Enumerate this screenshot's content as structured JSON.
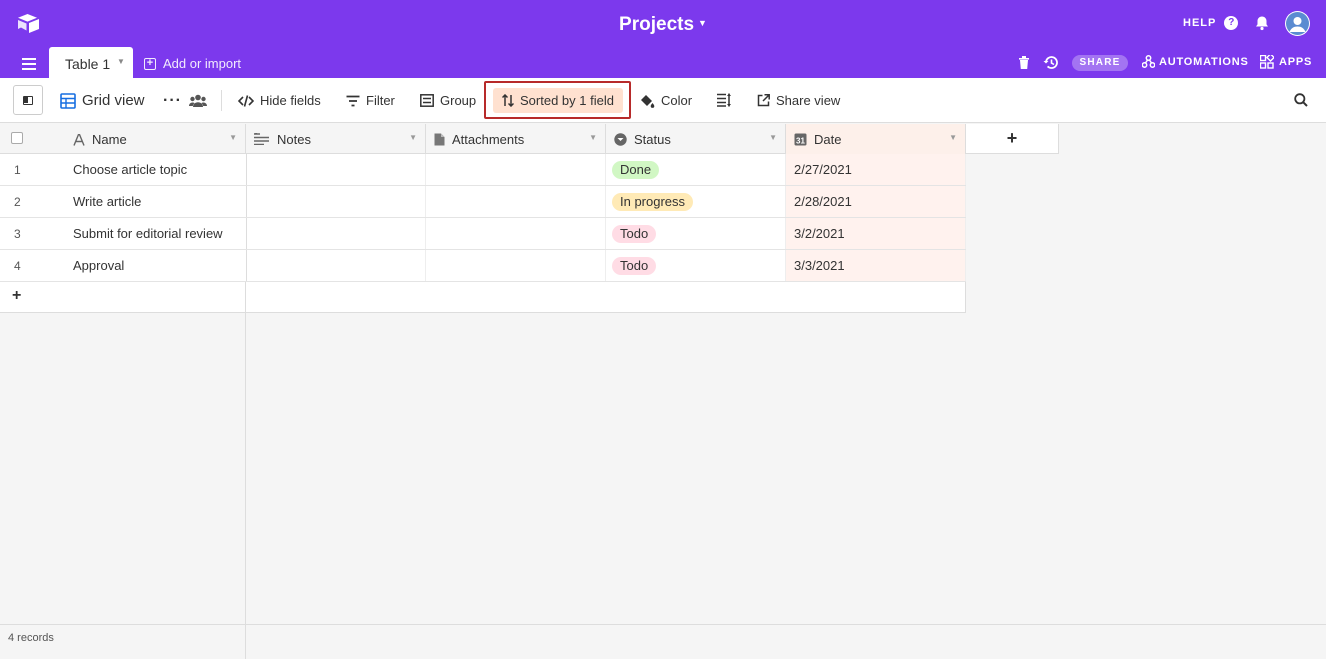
{
  "app": {
    "title": "Projects"
  },
  "header": {
    "help_label": "HELP",
    "help_icon_text": "?",
    "share_label": "SHARE",
    "automations_label": "AUTOMATIONS",
    "apps_label": "APPS"
  },
  "tabs": [
    {
      "label": "Table 1"
    }
  ],
  "add_import_label": "Add or import",
  "toolbar": {
    "view_name": "Grid view",
    "hide_fields": "Hide fields",
    "filter": "Filter",
    "group": "Group",
    "sort": "Sorted by 1 field",
    "color": "Color",
    "share_view": "Share view"
  },
  "columns": [
    {
      "label": "Name"
    },
    {
      "label": "Notes"
    },
    {
      "label": "Attachments"
    },
    {
      "label": "Status"
    },
    {
      "label": "Date"
    }
  ],
  "rows": [
    {
      "num": "1",
      "name": "Choose article topic",
      "status": "Done",
      "status_color": "#d1f7c4",
      "date": "2/27/2021"
    },
    {
      "num": "2",
      "name": "Write article",
      "status": "In progress",
      "status_color": "#ffeab6",
      "date": "2/28/2021"
    },
    {
      "num": "3",
      "name": "Submit for editorial review",
      "status": "Todo",
      "status_color": "#ffdce5",
      "date": "3/2/2021"
    },
    {
      "num": "4",
      "name": "Approval",
      "status": "Todo",
      "status_color": "#ffdce5",
      "date": "3/3/2021"
    }
  ],
  "add_row_symbol": "+",
  "add_column_symbol": "+",
  "footer": {
    "record_count": "4 records"
  },
  "colors": {
    "brand": "#7c39ed",
    "sort_highlight": "#ffe1d0",
    "date_column_bg": "#fff2ee",
    "annotation_border": "#b72a2a"
  }
}
